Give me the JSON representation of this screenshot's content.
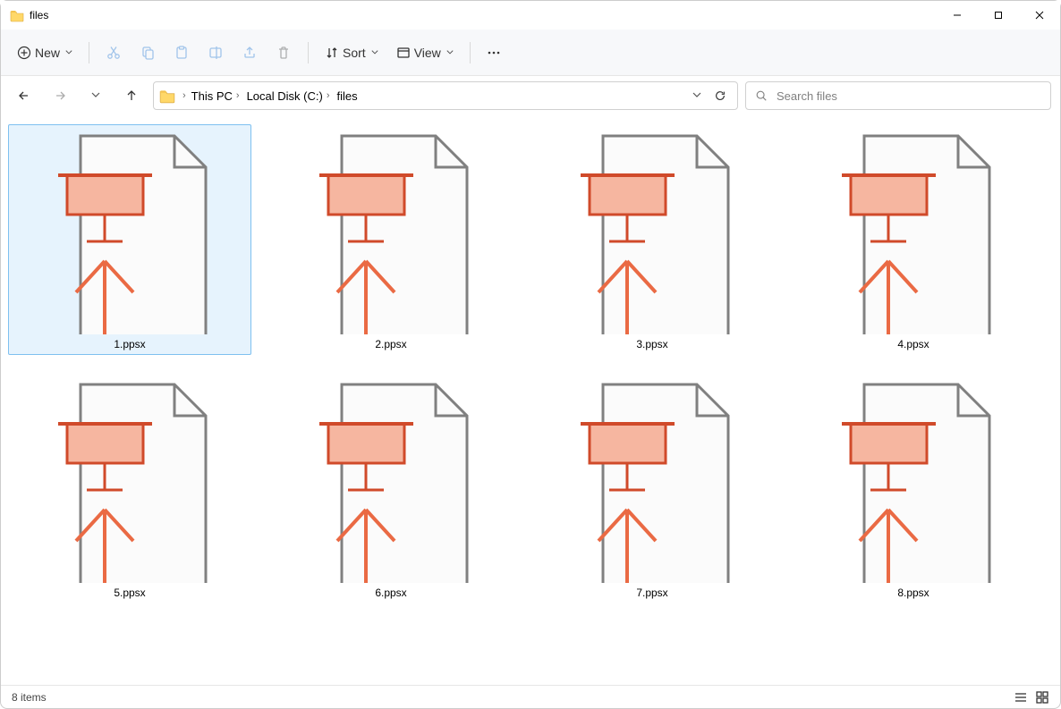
{
  "window": {
    "title": "files"
  },
  "toolbar": {
    "new_label": "New",
    "sort_label": "Sort",
    "view_label": "View"
  },
  "breadcrumb": {
    "items": [
      "This PC",
      "Local Disk (C:)",
      "files"
    ]
  },
  "search": {
    "placeholder": "Search files"
  },
  "files": [
    {
      "name": "1.ppsx",
      "selected": true
    },
    {
      "name": "2.ppsx",
      "selected": false
    },
    {
      "name": "3.ppsx",
      "selected": false
    },
    {
      "name": "4.ppsx",
      "selected": false
    },
    {
      "name": "5.ppsx",
      "selected": false
    },
    {
      "name": "6.ppsx",
      "selected": false
    },
    {
      "name": "7.ppsx",
      "selected": false
    },
    {
      "name": "8.ppsx",
      "selected": false
    }
  ],
  "status": {
    "text": "8 items"
  }
}
